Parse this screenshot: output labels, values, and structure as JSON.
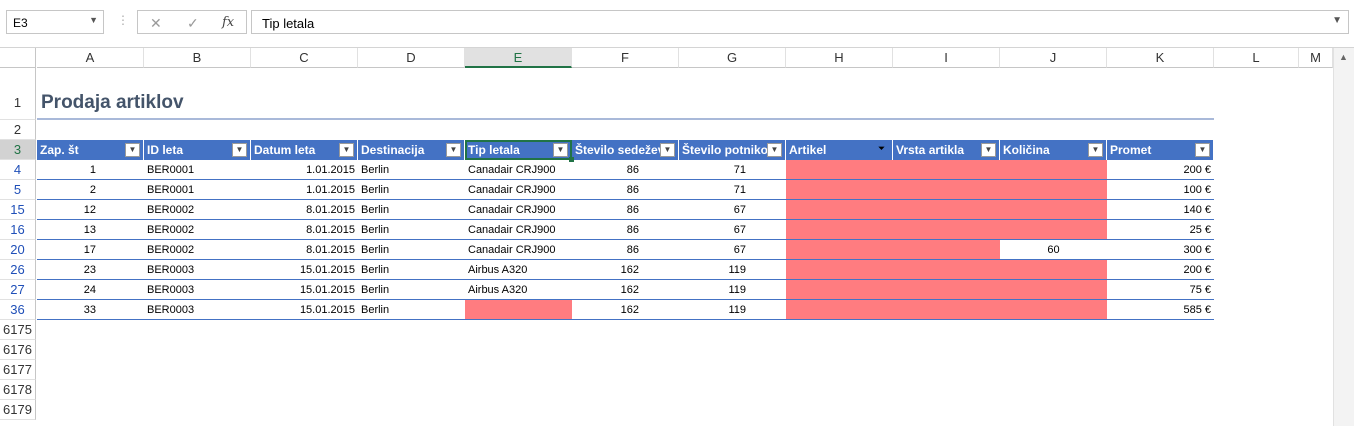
{
  "formula_bar": {
    "name_box": "E3",
    "cancel_icon": "✕",
    "enter_icon": "✓",
    "fx_label": "fx",
    "formula": "Tip letala"
  },
  "columns": [
    "A",
    "B",
    "C",
    "D",
    "E",
    "F",
    "G",
    "H",
    "I",
    "J",
    "K",
    "L",
    "M"
  ],
  "selected_column": "E",
  "title": "Prodaja artiklov",
  "row_numbers": [
    "1",
    "2",
    "3",
    "4",
    "5",
    "15",
    "16",
    "20",
    "26",
    "27",
    "36",
    "6175",
    "6176",
    "6177",
    "6178",
    "6179"
  ],
  "table": {
    "headers": [
      "Zap. št",
      "ID leta",
      "Datum leta",
      "Destinacija",
      "Tip letala",
      "Število sedežev",
      "Število potnikov",
      "Artikel",
      "Vrsta artikla",
      "Količina",
      "Promet"
    ],
    "rows": [
      {
        "zap": "1",
        "id": "BER0001",
        "datum": "1.01.2015",
        "dest": "Berlin",
        "tip": "Canadair CRJ900",
        "sedezi": "86",
        "potniki": "71",
        "kolicina": "",
        "promet": "200 €"
      },
      {
        "zap": "2",
        "id": "BER0001",
        "datum": "1.01.2015",
        "dest": "Berlin",
        "tip": "Canadair CRJ900",
        "sedezi": "86",
        "potniki": "71",
        "kolicina": "",
        "promet": "100 €"
      },
      {
        "zap": "12",
        "id": "BER0002",
        "datum": "8.01.2015",
        "dest": "Berlin",
        "tip": "Canadair CRJ900",
        "sedezi": "86",
        "potniki": "67",
        "kolicina": "",
        "promet": "140 €"
      },
      {
        "zap": "13",
        "id": "BER0002",
        "datum": "8.01.2015",
        "dest": "Berlin",
        "tip": "Canadair CRJ900",
        "sedezi": "86",
        "potniki": "67",
        "kolicina": "",
        "promet": "25 €"
      },
      {
        "zap": "17",
        "id": "BER0002",
        "datum": "8.01.2015",
        "dest": "Berlin",
        "tip": "Canadair CRJ900",
        "sedezi": "86",
        "potniki": "67",
        "kolicina": "60",
        "promet": "300 €"
      },
      {
        "zap": "23",
        "id": "BER0003",
        "datum": "15.01.2015",
        "dest": "Berlin",
        "tip": "Airbus A320",
        "sedezi": "162",
        "potniki": "119",
        "kolicina": "",
        "promet": "200 €"
      },
      {
        "zap": "24",
        "id": "BER0003",
        "datum": "15.01.2015",
        "dest": "Berlin",
        "tip": "Airbus A320",
        "sedezi": "162",
        "potniki": "119",
        "kolicina": "",
        "promet": "75 €"
      },
      {
        "zap": "33",
        "id": "BER0003",
        "datum": "15.01.2015",
        "dest": "Berlin",
        "tip": "",
        "sedezi": "162",
        "potniki": "119",
        "kolicina": "",
        "promet": "585 €"
      }
    ]
  },
  "colors": {
    "header_fill": "#4472c4",
    "highlight_fill": "#ff7c80",
    "selection": "#217346"
  }
}
